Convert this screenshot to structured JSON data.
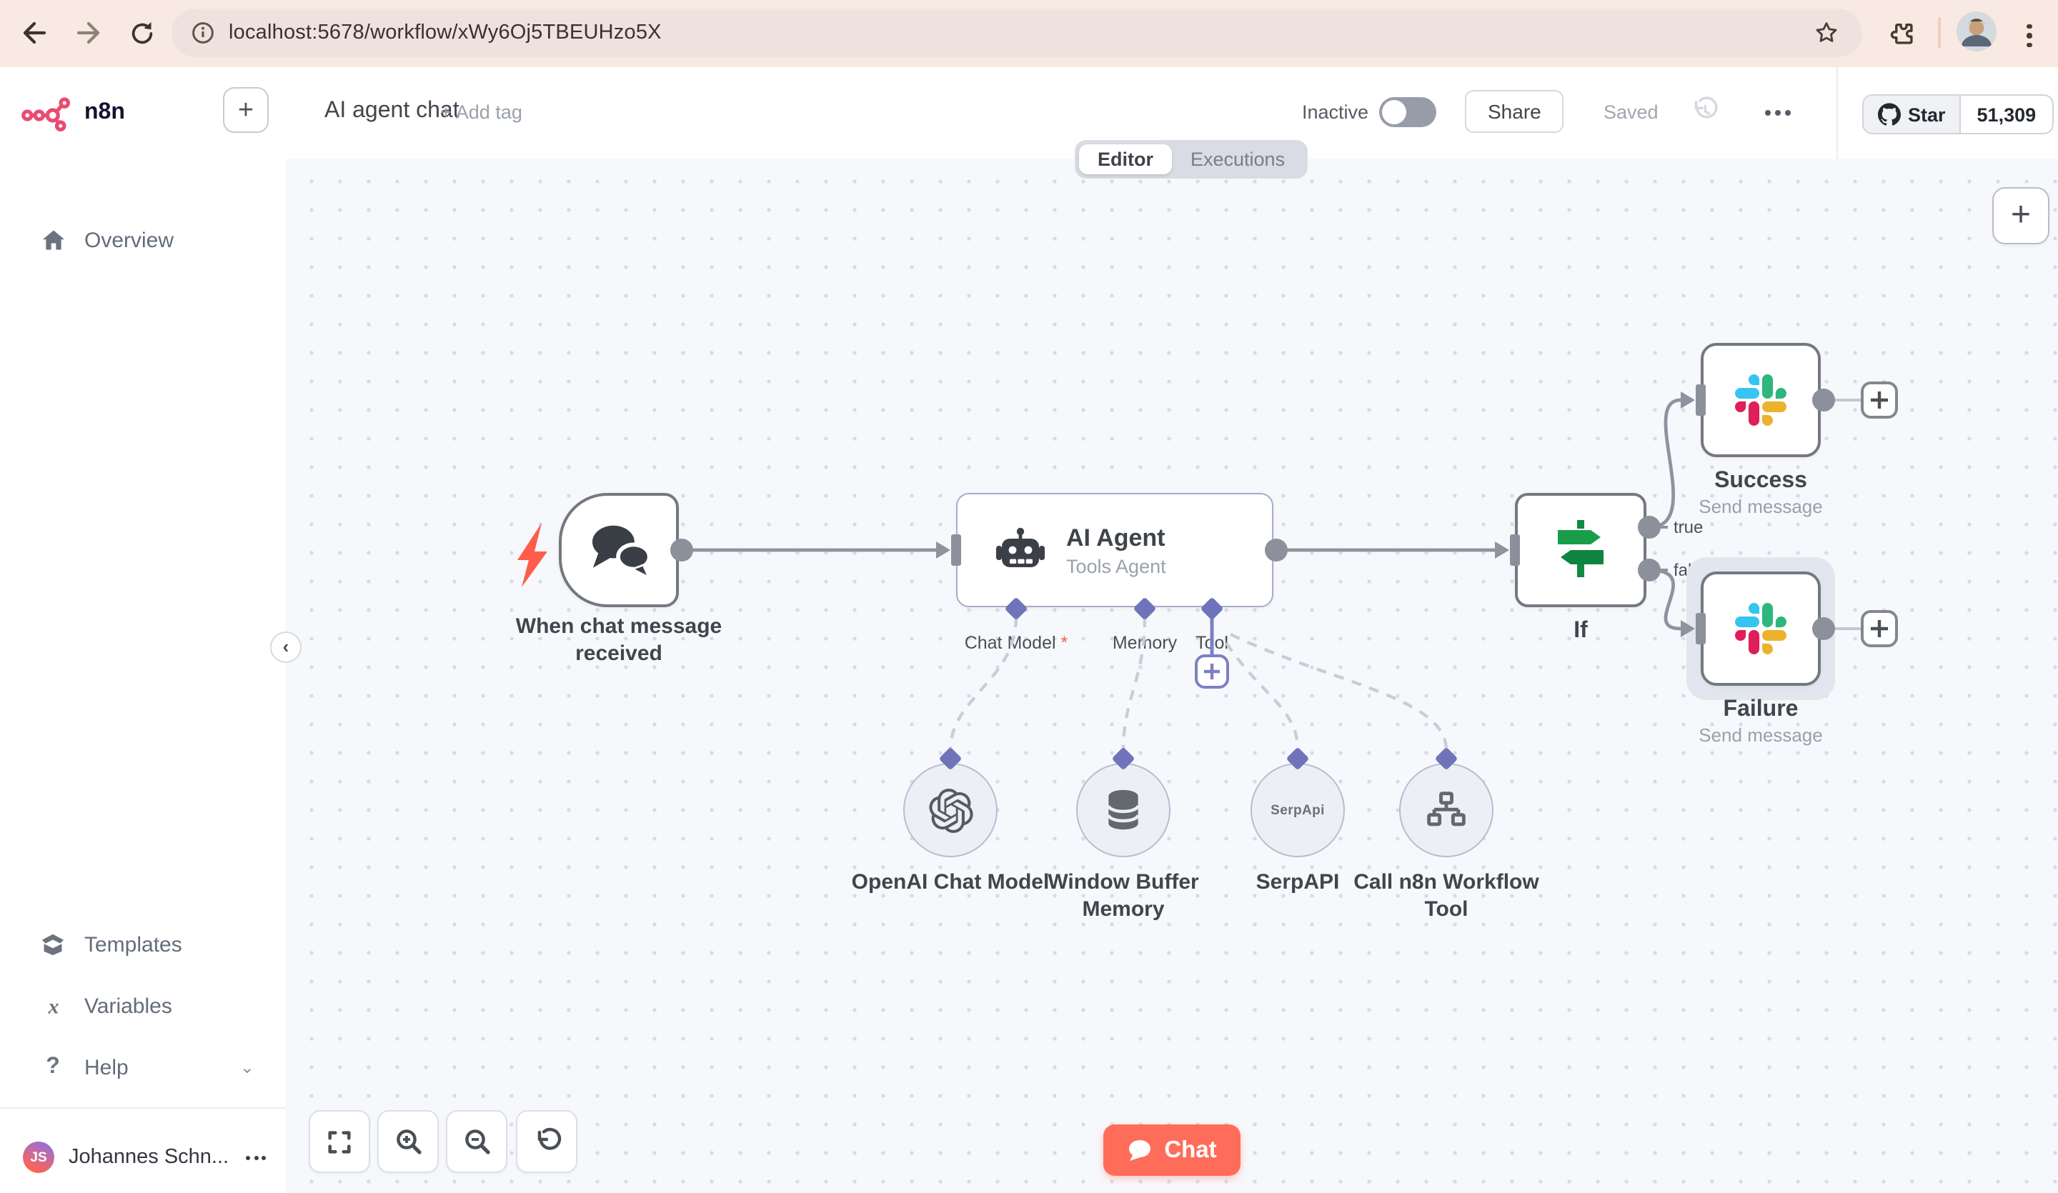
{
  "browser": {
    "url": "localhost:5678/workflow/xWy6Oj5TBEUHzo5X"
  },
  "sidebar": {
    "logo": "n8n",
    "overview": "Overview",
    "templates": "Templates",
    "variables": "Variables",
    "help": "Help",
    "user": {
      "initials": "JS",
      "name": "Johannes Schn..."
    }
  },
  "header": {
    "title": "AI agent chat",
    "add_tag": "+ Add tag",
    "activation": "Inactive",
    "share": "Share",
    "saved": "Saved",
    "github": {
      "star_label": "Star",
      "star_count": "51,309"
    }
  },
  "tabs": {
    "editor": "Editor",
    "executions": "Executions"
  },
  "canvas": {
    "trigger": {
      "name": "When chat message received"
    },
    "agent": {
      "title": "AI Agent",
      "subtitle": "Tools Agent",
      "connectors": [
        {
          "label": "Chat Model",
          "required": "*"
        },
        {
          "label": "Memory",
          "required": ""
        },
        {
          "label": "Tool",
          "required": ""
        }
      ]
    },
    "if_node": {
      "name": "If",
      "outputs": [
        "true",
        "false"
      ]
    },
    "success": {
      "name": "Success",
      "subtitle": "Send message"
    },
    "failure": {
      "name": "Failure",
      "subtitle": "Send message"
    },
    "subnodes": [
      {
        "name": "OpenAI Chat Model"
      },
      {
        "name": "Window Buffer Memory"
      },
      {
        "name": "SerpAPI",
        "icon_text": "SerpApi"
      },
      {
        "name": "Call n8n Workflow Tool"
      }
    ],
    "chat_button": "Chat"
  },
  "colors": {
    "accent_pink": "#ea4b71",
    "connector_purple": "#6f74ba",
    "chat_orange": "#ff6d5a",
    "if_green": "#149041",
    "slack": [
      "#36C5F0",
      "#2EB67D",
      "#E01E5A",
      "#ECB22E"
    ]
  }
}
